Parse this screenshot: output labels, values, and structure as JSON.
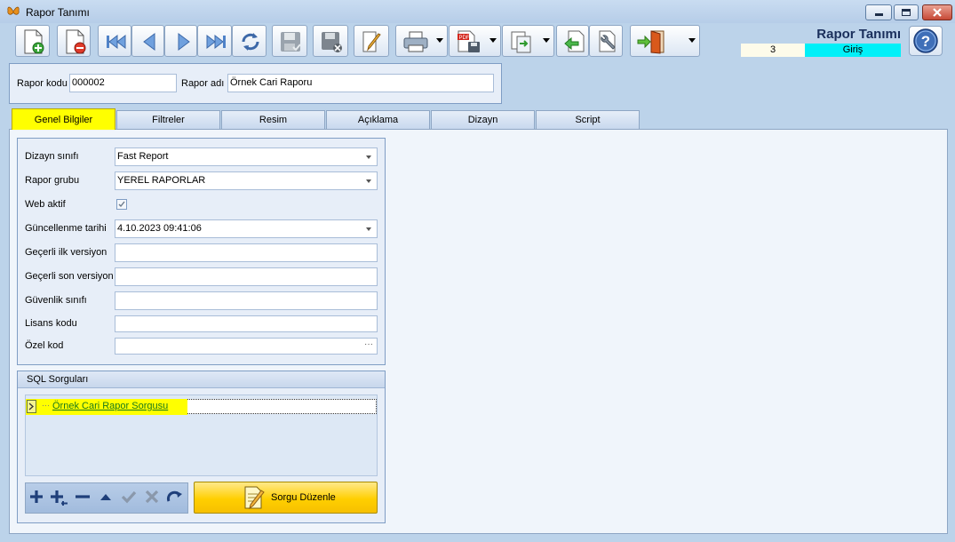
{
  "window": {
    "title": "Rapor Tanımı"
  },
  "header": {
    "form_title": "Rapor Tanımı",
    "record_count": "3",
    "mode": "Giriş"
  },
  "report": {
    "code_label": "Rapor kodu",
    "code_value": "000002",
    "name_label": "Rapor adı",
    "name_value": "Örnek Cari Raporu"
  },
  "tabs": [
    {
      "label": "Genel Bilgiler",
      "active": true
    },
    {
      "label": "Filtreler"
    },
    {
      "label": "Resim"
    },
    {
      "label": "Açıklama"
    },
    {
      "label": "Dizayn"
    },
    {
      "label": "Script"
    }
  ],
  "general": {
    "design_class_label": "Dizayn sınıfı",
    "design_class_value": "Fast Report",
    "report_group_label": "Rapor grubu",
    "report_group_value": "YEREL RAPORLAR",
    "web_active_label": "Web aktif",
    "web_active_checked": true,
    "updated_label": "Güncellenme tarihi",
    "updated_value": "4.10.2023 09:41:06",
    "first_version_label": "Geçerli ilk versiyon",
    "first_version_value": "",
    "last_version_label": "Geçerli son versiyon",
    "last_version_value": "",
    "security_class_label": "Güvenlik sınıfı",
    "security_class_value": "",
    "license_code_label": "Lisans kodu",
    "license_code_value": "",
    "special_code_label": "Özel kod",
    "special_code_value": "",
    "ellipsis": "···"
  },
  "sql": {
    "title": "SQL Sorguları",
    "items": [
      {
        "name": "Örnek Cari Rapor Sorgusu"
      }
    ],
    "edit_button": "Sorgu Düzenle"
  },
  "colors": {
    "active_tab": "#ffff00",
    "mode_bg": "#00f0f8",
    "title_text": "#1a2f5c",
    "edit_button": "#ffcf00"
  }
}
